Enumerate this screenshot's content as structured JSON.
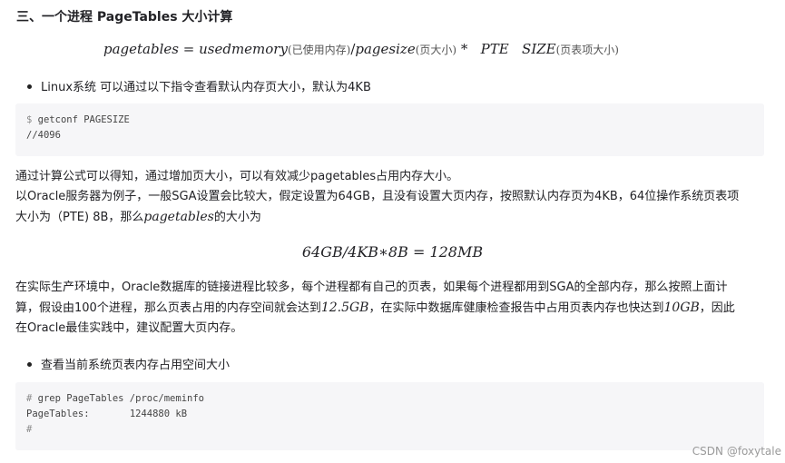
{
  "heading": "三、一个进程 PageTables 大小计算",
  "formula1": {
    "lhs": "pagetables",
    "eq": "=",
    "used": "usedmemory",
    "used_note": "(已使用内存)",
    "slash": "/",
    "pagesize": "pagesize",
    "pagesize_note": "(页大小)",
    "mul": "*",
    "pte": "PTE",
    "size": "SIZE",
    "size_note": "(页表项大小)"
  },
  "bullet1": "Linux系统 可以通过以下指令查看默认内存页大小，默认为4KB",
  "code1": {
    "prompt": "$",
    "command": "getconf PAGESIZE",
    "output": "//4096"
  },
  "para1": {
    "line1": "通过计算公式可以得知，通过增加页大小，可以有效减少pagetables占用内存大小。",
    "line2": "以Oracle服务器为例子，一般SGA设置会比较大，假定设置为64GB，且没有设置大页内存，按照默认内存页为4KB，64位操作系统页表项",
    "line3_pre": "大小为（PTE) 8B，那么",
    "line3_math": "pagetables",
    "line3_post": "的大小为"
  },
  "formula2": "64GB/4KB∗8B = 128MB",
  "para2": {
    "line1": "在实际生产环境中，Oracle数据库的链接进程比较多，每个进程都有自己的页表，如果每个进程都用到SGA的全部内存，那么按照上面计",
    "line2_pre": "算，假设由100个进程，那么页表占用的内存空间就会达到",
    "line2_math1": "12.5GB",
    "line2_mid": "，在实际中数据库健康检查报告中占用页表内存也快达到",
    "line2_math2": "10GB",
    "line2_post": "，因此",
    "line3": "在Oracle最佳实践中，建议配置大页内存。"
  },
  "bullet2": "查看当前系统页表内存占用空间大小",
  "code2": {
    "prompt1": "#",
    "command": "grep PageTables /proc/meminfo",
    "output_label": "PageTables:",
    "output_value": "1244880 kB",
    "prompt2": "#"
  },
  "watermark": "CSDN @foxytale"
}
